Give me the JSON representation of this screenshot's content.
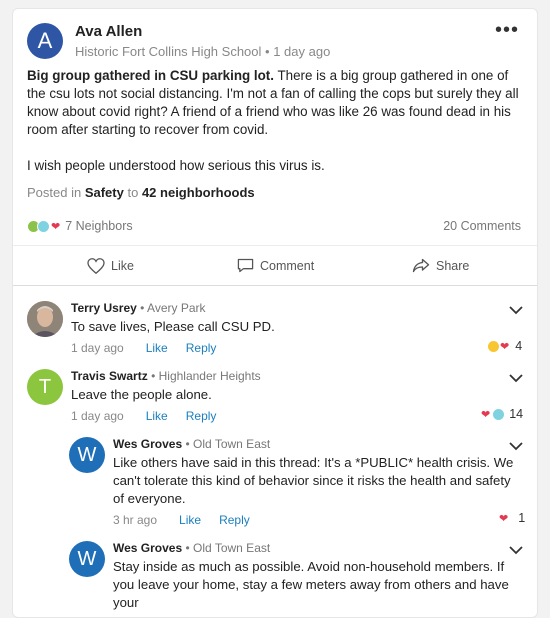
{
  "post": {
    "author": "Ava Allen",
    "avatar_letter": "A",
    "location": "Historic Fort Collins High School",
    "time": "1 day ago",
    "headline": "Big group gathered in CSU parking lot.",
    "body1": "There is a big group gathered in one of the csu lots not social distancing. I'm not a fan of calling the cops but surely they all know about covid right? A friend of a friend who was like 26 was found dead in his room after starting to recover from covid.",
    "body2": "I wish people understood how serious this virus is.",
    "posted_prefix": "Posted in",
    "category": "Safety",
    "to_word": "to",
    "audience": "42 neighborhoods",
    "reactions_count": "7 Neighbors",
    "comments_count": "20 Comments"
  },
  "actions": {
    "like": "Like",
    "comment": "Comment",
    "share": "Share"
  },
  "comments": [
    {
      "name": "Terry Usrey",
      "hood": "Avery Park",
      "text": "To save lives, Please call CSU PD.",
      "time": "1 day ago",
      "like": "Like",
      "reply": "Reply",
      "reaction_count": "4"
    },
    {
      "name": "Travis Swartz",
      "hood": "Highlander Heights",
      "avatar_letter": "T",
      "text": "Leave the people alone.",
      "time": "1 day ago",
      "like": "Like",
      "reply": "Reply",
      "reaction_count": "14"
    },
    {
      "name": "Wes Groves",
      "hood": "Old Town East",
      "avatar_letter": "W",
      "text": "Like others have said in this thread: It's a *PUBLIC* health crisis. We can't tolerate this kind of behavior since it risks the health and safety of everyone.",
      "time": "3 hr ago",
      "like": "Like",
      "reply": "Reply",
      "reaction_count": "1"
    },
    {
      "name": "Wes Groves",
      "hood": "Old Town East",
      "avatar_letter": "W",
      "text": "Stay inside as much as possible. Avoid non-household members. If you leave your home, stay a few meters away from others and have your"
    }
  ],
  "colors": {
    "avatar_a": "#2f56a5",
    "avatar_t": "#8cc63f",
    "avatar_w": "#1e6fb8",
    "link": "#1b7fbf",
    "heart": "#e53950"
  }
}
